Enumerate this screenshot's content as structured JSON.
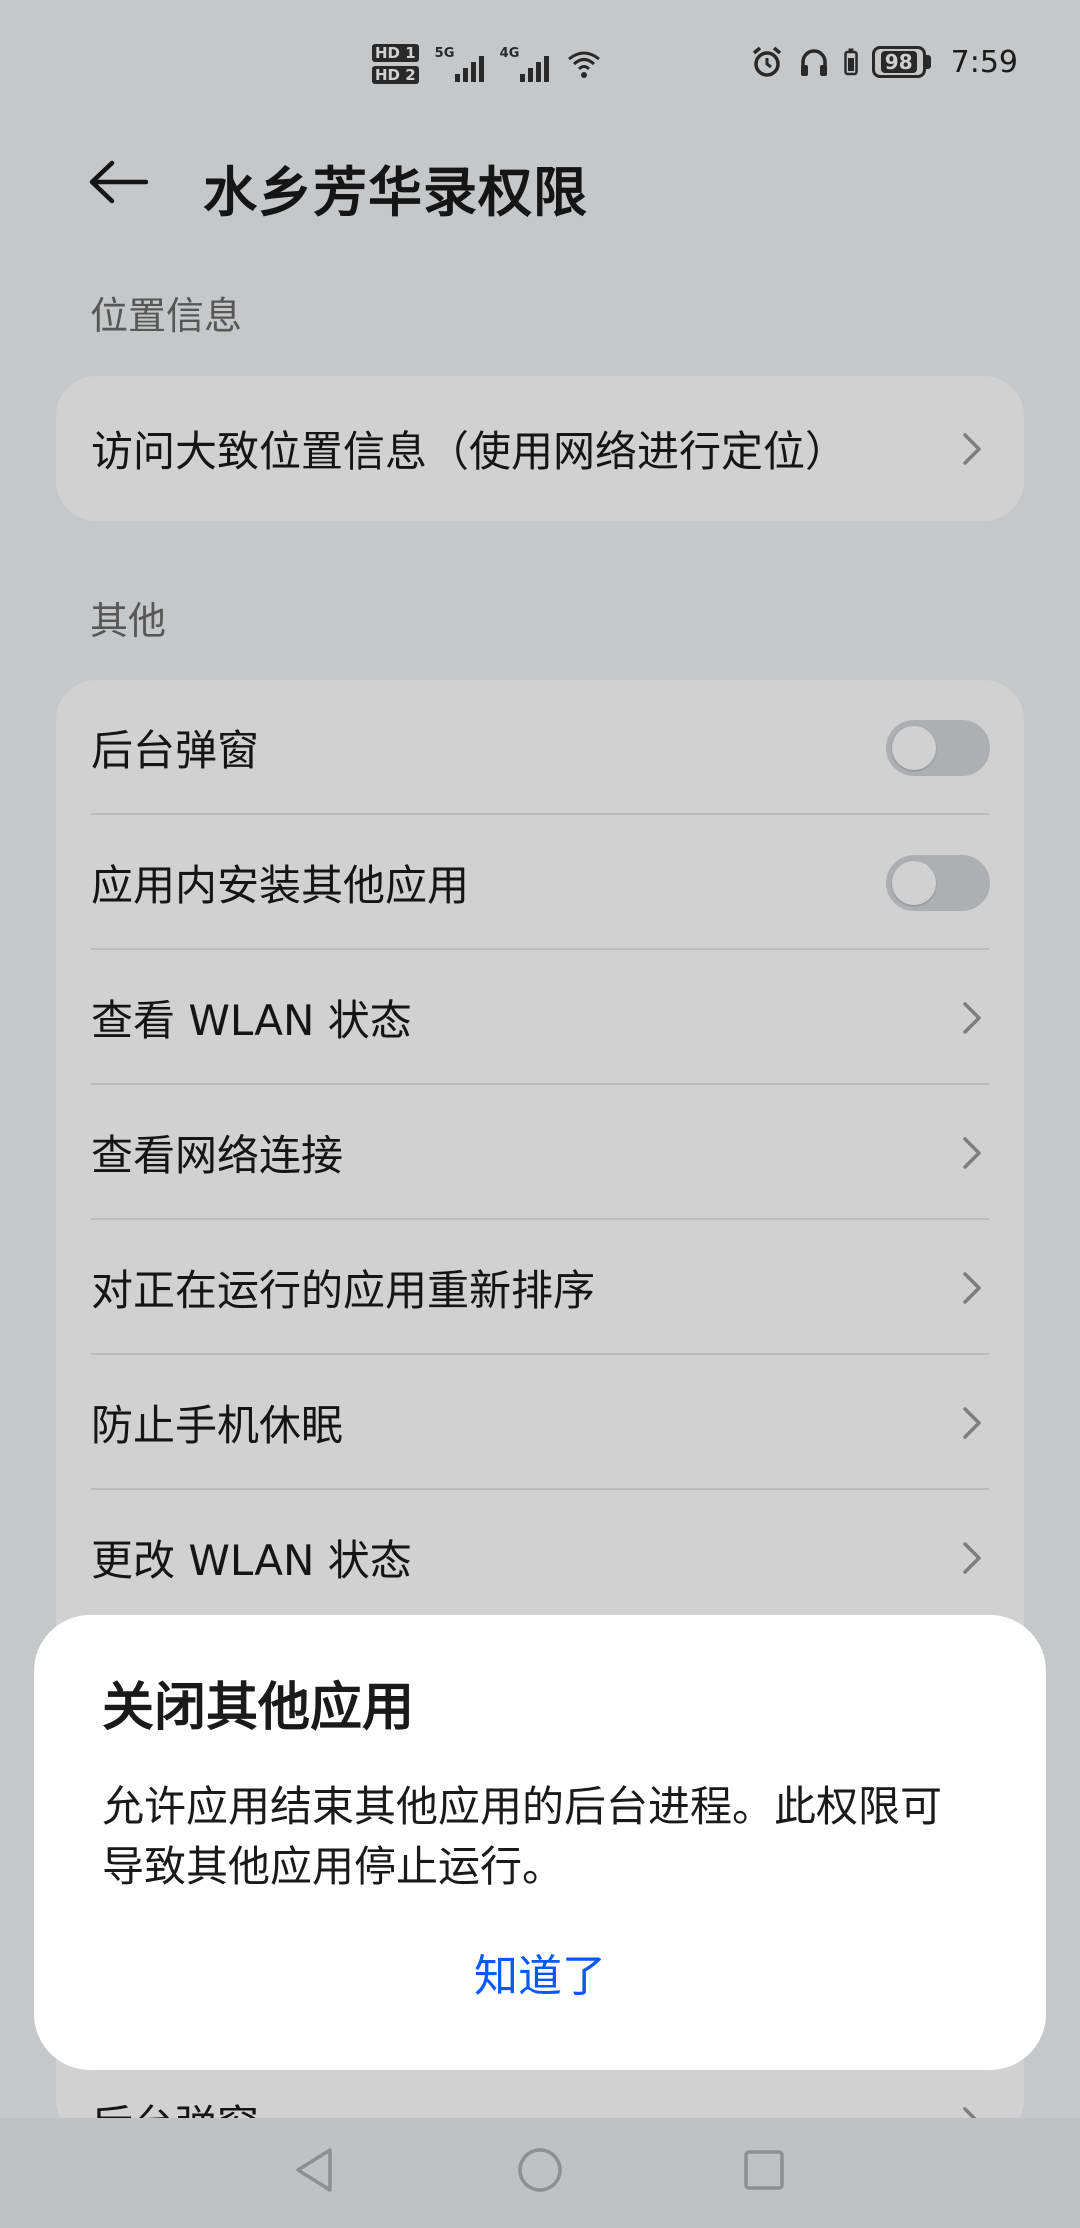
{
  "status_bar": {
    "sim1": "HD 1",
    "sim2": "HD 2",
    "net1": "5G",
    "net2": "4G",
    "battery": "98",
    "time": "7:59"
  },
  "header": {
    "title": "水乡芳华录权限"
  },
  "sections": {
    "location": {
      "label": "位置信息",
      "items": [
        {
          "label": "访问大致位置信息（使用网络进行定位）"
        }
      ]
    },
    "other": {
      "label": "其他",
      "items": [
        {
          "label": "后台弹窗"
        },
        {
          "label": "应用内安装其他应用"
        },
        {
          "label": "查看 WLAN 状态"
        },
        {
          "label": "查看网络连接"
        },
        {
          "label": "对正在运行的应用重新排序"
        },
        {
          "label": "防止手机休眠"
        },
        {
          "label": "更改 WLAN 状态"
        },
        {
          "label": "后台弹窗"
        }
      ]
    }
  },
  "dialog": {
    "title": "关闭其他应用",
    "body": "允许应用结束其他应用的后台进程。此权限可导致其他应用停止运行。",
    "ok_label": "知道了"
  },
  "colors": {
    "accent": "#0a59f7",
    "background": "#f1f3f5",
    "card": "#ffffff"
  }
}
